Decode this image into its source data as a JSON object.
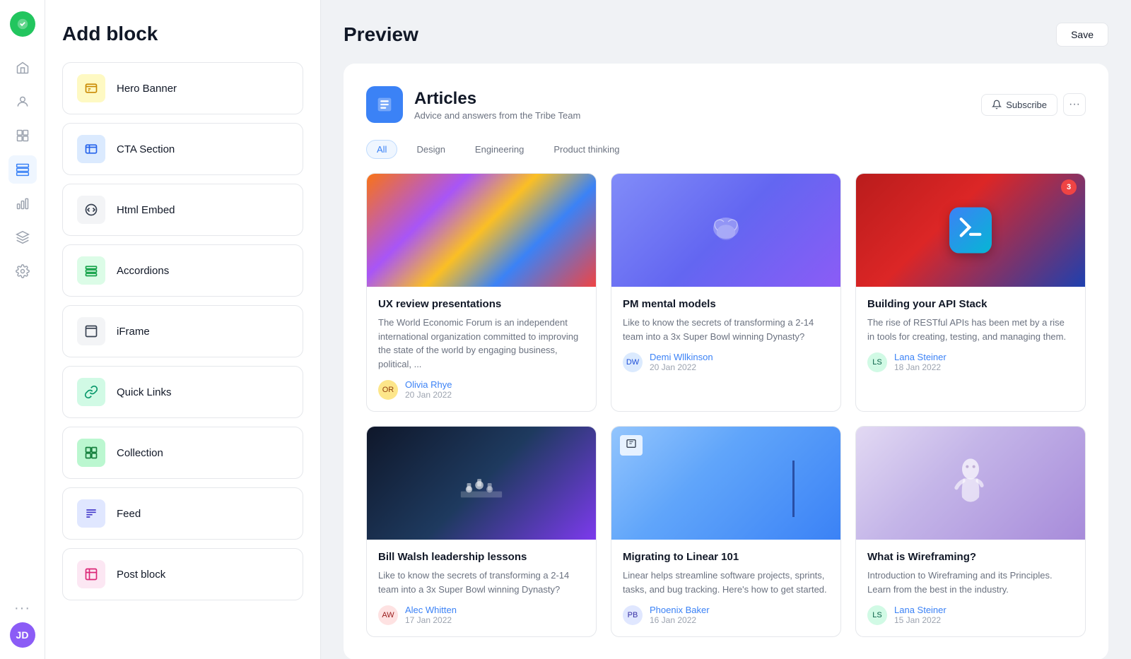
{
  "header": {
    "title": "Add block",
    "preview_title": "Preview",
    "save_label": "Save"
  },
  "sidebar": {
    "toggle_state": "on",
    "icons": [
      {
        "name": "home-icon",
        "label": "Home"
      },
      {
        "name": "users-icon",
        "label": "Users"
      },
      {
        "name": "pages-icon",
        "label": "Pages"
      },
      {
        "name": "blocks-icon",
        "label": "Blocks",
        "active": true
      },
      {
        "name": "analytics-icon",
        "label": "Analytics"
      },
      {
        "name": "layers-icon",
        "label": "Layers"
      },
      {
        "name": "settings-icon",
        "label": "Settings"
      }
    ],
    "more_label": "...",
    "avatar_initials": "JD"
  },
  "blocks": [
    {
      "id": "hero-banner",
      "label": "Hero Banner",
      "icon": "hero-icon",
      "bg": "bg-yellow",
      "col": "col-yellow"
    },
    {
      "id": "cta-section",
      "label": "CTA Section",
      "icon": "cta-icon",
      "bg": "bg-blue",
      "col": "col-blue"
    },
    {
      "id": "html-embed",
      "label": "Html Embed",
      "icon": "html-icon",
      "bg": "bg-gray",
      "col": "col-gray"
    },
    {
      "id": "accordions",
      "label": "Accordions",
      "icon": "accordion-icon",
      "bg": "bg-green",
      "col": "col-green"
    },
    {
      "id": "iframe",
      "label": "iFrame",
      "icon": "iframe-icon",
      "bg": "bg-gray",
      "col": "col-gray"
    },
    {
      "id": "quick-links",
      "label": "Quick Links",
      "icon": "link-icon",
      "bg": "bg-teal",
      "col": "col-teal"
    },
    {
      "id": "collection",
      "label": "Collection",
      "icon": "collection-icon",
      "bg": "bg-green2",
      "col": "col-green2"
    },
    {
      "id": "feed",
      "label": "Feed",
      "icon": "feed-icon",
      "bg": "bg-indigo",
      "col": "col-indigo"
    },
    {
      "id": "post-block",
      "label": "Post block",
      "icon": "post-icon",
      "bg": "bg-pink",
      "col": "col-pink"
    }
  ],
  "preview": {
    "articles": {
      "title": "Articles",
      "subtitle": "Advice and answers from the Tribe Team",
      "subscribe_label": "Subscribe",
      "tabs": [
        "All",
        "Design",
        "Engineering",
        "Product thinking"
      ],
      "active_tab": "All",
      "cards": [
        {
          "id": "card-1",
          "title": "UX review presentations",
          "desc": "The World Economic Forum is an independent international organization committed to improving the state of the world by engaging business, political, ...",
          "author": "Olivia Rhye",
          "date": "20 Jan 2022",
          "img_color": "#c084fc",
          "img_type": "colorful"
        },
        {
          "id": "card-2",
          "title": "PM mental models",
          "desc": "Like to know the secrets of transforming a 2-14 team into a 3x Super Bowl winning Dynasty?",
          "author": "Demi Wllkinson",
          "date": "20 Jan 2022",
          "img_color": "#818cf8",
          "img_type": "brain"
        },
        {
          "id": "card-3",
          "title": "Building your API Stack",
          "desc": "The rise of RESTful APIs has been met by a rise in tools for creating, testing, and managing them.",
          "author": "Lana Steiner",
          "date": "18 Jan 2022",
          "img_color": "#ef4444",
          "img_type": "appstore"
        },
        {
          "id": "card-4",
          "title": "Bill Walsh leadership lessons",
          "desc": "Like to know the secrets of transforming a 2-14 team into a 3x Super Bowl winning Dynasty?",
          "author": "Alec Whitten",
          "date": "17 Jan 2022",
          "img_color": "#1e3a5f",
          "img_type": "chess"
        },
        {
          "id": "card-5",
          "title": "Migrating to Linear 101",
          "desc": "Linear helps streamline software projects, sprints, tasks, and bug tracking. Here's how to get started.",
          "author": "Phoenix Baker",
          "date": "16 Jan 2022",
          "img_color": "#93c5fd",
          "img_type": "door"
        },
        {
          "id": "card-6",
          "title": "What is Wireframing?",
          "desc": "Introduction to Wireframing and its Principles. Learn from the best in the industry.",
          "author": "Lana Steiner",
          "date": "15 Jan 2022",
          "img_color": "#d6bcfa",
          "img_type": "statue"
        }
      ]
    }
  }
}
